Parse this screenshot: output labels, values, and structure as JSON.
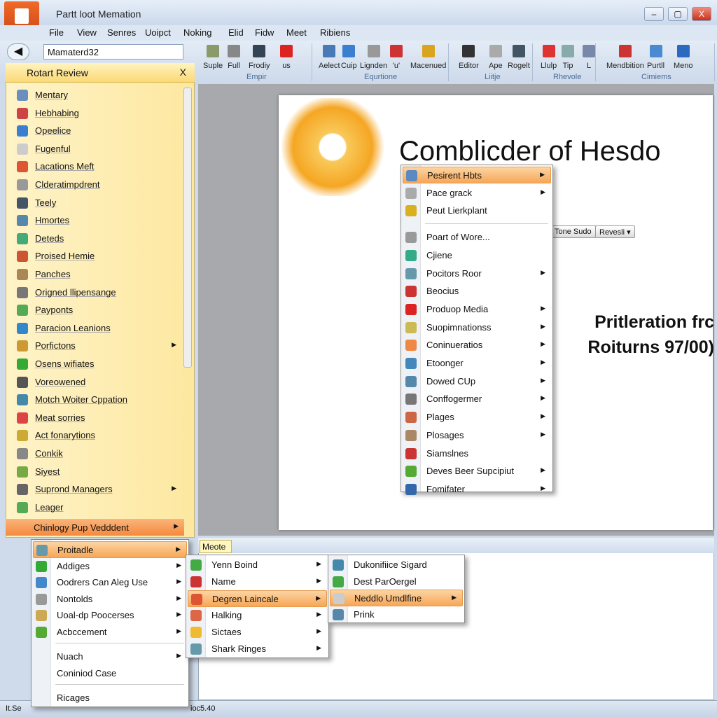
{
  "window": {
    "title": "Partt loot Memation",
    "office_button": "G",
    "controls": [
      "–",
      "▢",
      "X"
    ]
  },
  "menubar": [
    "File",
    "View",
    "Senres",
    "Uoipct",
    "Noking",
    "Elid",
    "Fidw",
    "Meet",
    "Ribiens"
  ],
  "nav": {
    "address": "Mamaterd32"
  },
  "ribbon": {
    "buttons": [
      {
        "label": "Suple",
        "color": "#8a9a6a"
      },
      {
        "label": "Full",
        "color": "#888"
      },
      {
        "label": "Frodiy",
        "color": "#345"
      },
      {
        "label": "us",
        "color": "#d22"
      },
      {
        "label": "Aelect",
        "color": "#4a7ab5"
      },
      {
        "label": "Cuip",
        "color": "#3a7fd0"
      },
      {
        "label": "Lignden",
        "color": "#999"
      },
      {
        "label": "'u'",
        "color": "#c33"
      },
      {
        "label": "Macenued",
        "color": "#d9a520"
      },
      {
        "label": "Editor",
        "color": "#333"
      },
      {
        "label": "Ape",
        "color": "#aaa"
      },
      {
        "label": "Rogelt",
        "color": "#456"
      },
      {
        "label": "Llulp",
        "color": "#d33"
      },
      {
        "label": "Tip",
        "color": "#8aa"
      },
      {
        "label": "L",
        "color": "#78a"
      },
      {
        "label": "Mendbition",
        "color": "#c33"
      },
      {
        "label": "Purtll",
        "color": "#4a8ad0"
      },
      {
        "label": "Meno",
        "color": "#2a6ac0"
      }
    ],
    "groups": [
      "Empir",
      "Equrtione",
      "Liitje",
      "Rhevole",
      "Cimiems"
    ]
  },
  "sidebar": {
    "title": "Rotart Review",
    "close": "X",
    "items": [
      {
        "label": "Mentary",
        "color": "#6a8fbf"
      },
      {
        "label": "Hebhabing",
        "color": "#c44"
      },
      {
        "label": "Opeelice",
        "color": "#3a7fd0"
      },
      {
        "label": "Fugenful",
        "color": "#ccc"
      },
      {
        "label": "Lacations Meft",
        "color": "#d53"
      },
      {
        "label": "Clderatimpdrent",
        "color": "#999"
      },
      {
        "label": "Teely",
        "color": "#456"
      },
      {
        "label": "Hmortes",
        "color": "#58a"
      },
      {
        "label": "Deteds",
        "color": "#4a7"
      },
      {
        "label": "Proised Hemie",
        "color": "#c53"
      },
      {
        "label": "Panches",
        "color": "#a85"
      },
      {
        "label": "Origned llipensange",
        "color": "#777"
      },
      {
        "label": "Payponts",
        "color": "#5a5"
      },
      {
        "label": "Paracion Leanions",
        "color": "#38c"
      },
      {
        "label": "Porfictons",
        "color": "#c93",
        "arrow": true
      },
      {
        "label": "Osens wifiates",
        "color": "#3a3"
      },
      {
        "label": "Voreowened",
        "color": "#555"
      },
      {
        "label": "Motch Woiter Cppation",
        "color": "#48a"
      },
      {
        "label": "Meat sorries",
        "color": "#d44"
      },
      {
        "label": "Act fonarytions",
        "color": "#ca3"
      },
      {
        "label": "Conkik",
        "color": "#888"
      },
      {
        "label": "Siyest",
        "color": "#7a4"
      },
      {
        "label": "Suprond Managers",
        "color": "#666",
        "arrow": true
      },
      {
        "label": "Leager",
        "color": "#5a5"
      }
    ],
    "highlighted": "Chinlogy Pup Vedddent"
  },
  "slide": {
    "title": "Comblicder of Hesdo",
    "subtitle_line1": "Pritleration frc",
    "subtitle_line2": "Roiturns 97/00)",
    "button1": "Tone Sudo",
    "button2": "Revesli ▾"
  },
  "context_menu": [
    {
      "label": "Pesirent Hbts",
      "arrow": true,
      "hi": true,
      "color": "#5a8ac0"
    },
    {
      "label": "Pace grack",
      "arrow": true,
      "color": "#aaa"
    },
    {
      "label": "Peut Lierkplant",
      "color": "#d9b020"
    },
    {
      "sep": true
    },
    {
      "label": "Poart of Wore...",
      "color": "#999"
    },
    {
      "label": "Cjiene",
      "color": "#3a8"
    },
    {
      "label": "Pocitors Roor",
      "arrow": true,
      "color": "#69a"
    },
    {
      "label": "Beocius",
      "color": "#c33"
    },
    {
      "label": "Produop Media",
      "arrow": true,
      "color": "#d22"
    },
    {
      "label": "Suopimnationss",
      "arrow": true,
      "color": "#cb5"
    },
    {
      "label": "Coninueratios",
      "arrow": true,
      "color": "#e84"
    },
    {
      "label": "Etoonger",
      "arrow": true,
      "color": "#48b"
    },
    {
      "label": "Dowed CUp",
      "arrow": true,
      "color": "#58a"
    },
    {
      "label": "Conffogermer",
      "arrow": true,
      "color": "#777"
    },
    {
      "label": "Plages",
      "arrow": true,
      "color": "#c64"
    },
    {
      "label": "Plosages",
      "arrow": true,
      "color": "#a86"
    },
    {
      "label": "Siamslnes",
      "color": "#c33"
    },
    {
      "label": "Deves Beer Supcipiut",
      "arrow": true,
      "color": "#5a3"
    },
    {
      "label": "Fomifater",
      "arrow": true,
      "color": "#36a"
    }
  ],
  "bottom_pane": {
    "tab": "Meote"
  },
  "submenu1": [
    {
      "label": "Proitadle",
      "arrow": true,
      "hi": true,
      "color": "#69a"
    },
    {
      "label": "Addiges",
      "arrow": true,
      "color": "#3a3"
    },
    {
      "label": "Oodrers Can Aleg Use",
      "arrow": true,
      "color": "#48c"
    },
    {
      "label": "Nontolds",
      "arrow": true,
      "color": "#999"
    },
    {
      "label": "Uoal-dp Poocerses",
      "arrow": true,
      "color": "#ca5"
    },
    {
      "label": "Acbccement",
      "arrow": true,
      "color": "#5a3"
    },
    {
      "sep": true
    },
    {
      "label": "Nuach",
      "arrow": true
    },
    {
      "label": "Coniniod Case"
    },
    {
      "sep": true
    },
    {
      "label": "Ricages"
    }
  ],
  "submenu2": [
    {
      "label": "Yenn Boind",
      "arrow": true,
      "color": "#4a4"
    },
    {
      "label": "Name",
      "arrow": true,
      "color": "#c33"
    },
    {
      "label": "Degren Laincale",
      "arrow": true,
      "hi": true,
      "color": "#d53"
    },
    {
      "label": "Halking",
      "arrow": true,
      "color": "#d64"
    },
    {
      "label": "Sictaes",
      "arrow": true,
      "color": "#eb3"
    },
    {
      "label": "Shark Ringes",
      "arrow": true,
      "color": "#69a"
    }
  ],
  "submenu3": [
    {
      "label": "Dukonifiice Sigard",
      "color": "#48a"
    },
    {
      "label": "Dest ParOergel",
      "color": "#4a4"
    },
    {
      "label": "Neddlo Umdlfine",
      "arrow": true,
      "hi": true,
      "color": "#ccc"
    },
    {
      "label": "Prink",
      "color": "#58a"
    }
  ],
  "statusbar": {
    "left": "It.Se",
    "center": "ioc5.40"
  }
}
